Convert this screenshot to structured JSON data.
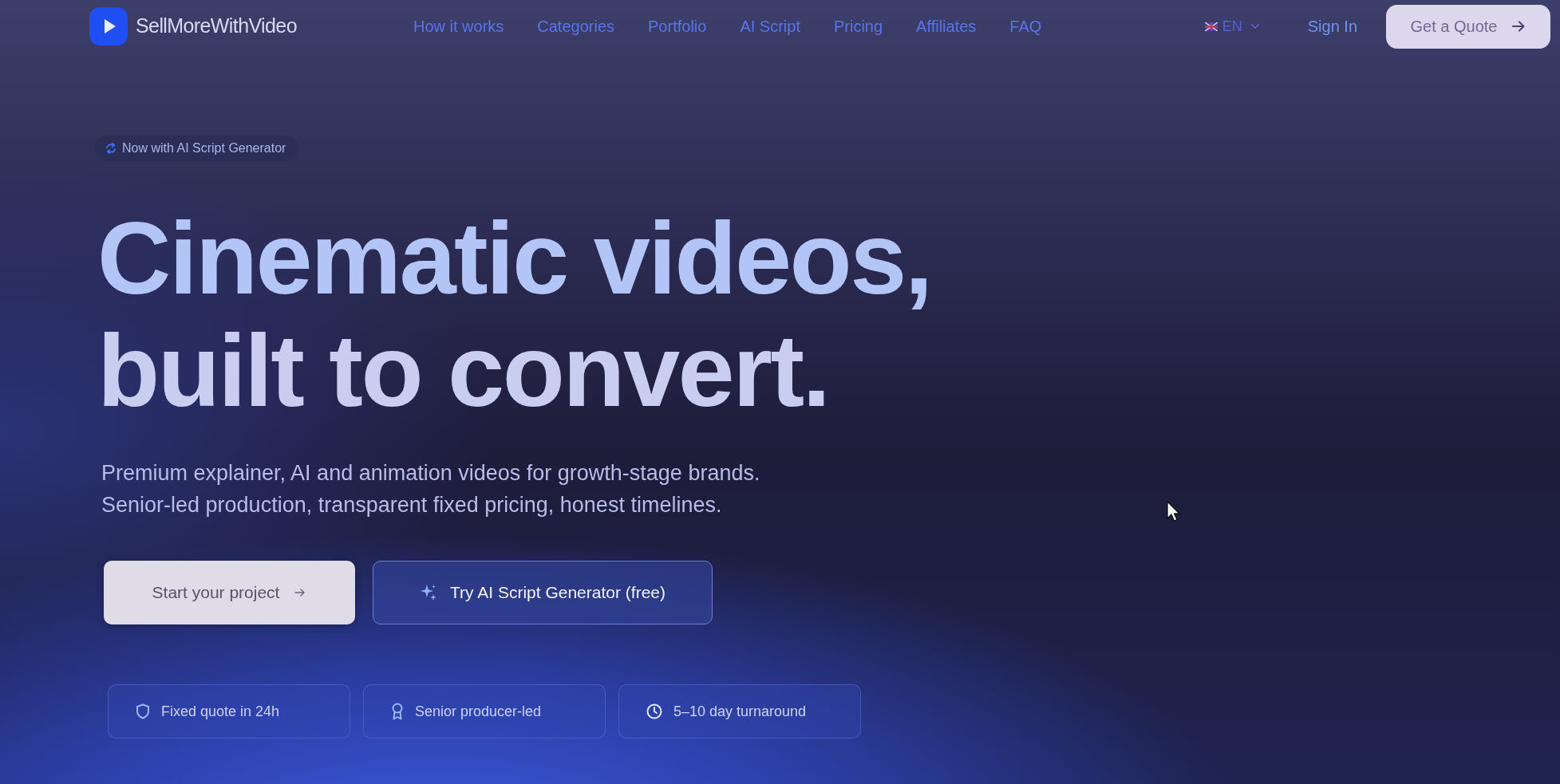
{
  "header": {
    "brand": "SellMoreWithVideo",
    "nav": [
      "How it works",
      "Categories",
      "Portfolio",
      "AI Script",
      "Pricing",
      "Affiliates",
      "FAQ"
    ],
    "language": "EN",
    "sign_in": "Sign In",
    "cta": "Get a Quote"
  },
  "hero": {
    "badge": "Now with AI Script Generator",
    "headline": [
      "Cinematic videos,",
      "built to convert."
    ],
    "subtitle": [
      "Premium explainer, AI and animation videos for growth-stage brands.",
      "Senior-led production, transparent fixed pricing, honest timelines."
    ],
    "buttons": [
      {
        "label": "Start your project",
        "kind": "primary"
      },
      {
        "label": "Try AI Script Generator (free)",
        "kind": "secondary"
      }
    ],
    "features": [
      "Fixed quote in 24h",
      "Senior producer-led",
      "5–10 day turnaround"
    ]
  }
}
